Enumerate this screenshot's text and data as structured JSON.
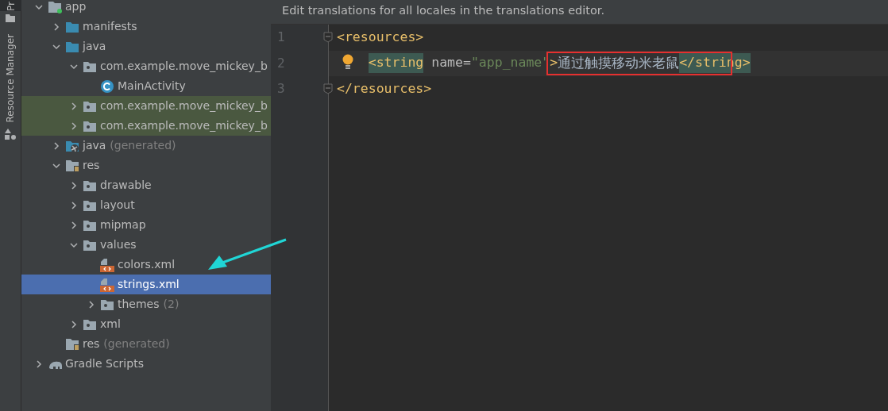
{
  "tool_strip": [
    {
      "label": "Pr",
      "selected": true
    },
    {
      "label": "Resource Manager",
      "selected": false
    }
  ],
  "tree": [
    {
      "label": "app",
      "kind": "module",
      "expanded": true,
      "selected": false,
      "highlighted": false,
      "children": [
        {
          "label": "manifests",
          "kind": "folder",
          "expanded": false,
          "selected": false,
          "highlighted": false
        },
        {
          "label": "java",
          "kind": "folder",
          "expanded": true,
          "selected": false,
          "highlighted": false,
          "children": [
            {
              "label": "com.example.move_mickey_b",
              "kind": "package",
              "expanded": true,
              "selected": false,
              "highlighted": false,
              "children": [
                {
                  "label": "MainActivity",
                  "kind": "class",
                  "selected": false,
                  "highlighted": false
                }
              ]
            },
            {
              "label": "com.example.move_mickey_b",
              "kind": "package",
              "expanded": false,
              "selected": false,
              "highlighted": true
            },
            {
              "label": "com.example.move_mickey_b",
              "kind": "package",
              "expanded": false,
              "selected": false,
              "highlighted": true
            }
          ]
        },
        {
          "label": "java",
          "note": "(generated)",
          "kind": "generated",
          "expanded": false,
          "selected": false,
          "highlighted": false
        },
        {
          "label": "res",
          "kind": "res",
          "expanded": true,
          "selected": false,
          "highlighted": false,
          "children": [
            {
              "label": "drawable",
              "kind": "package",
              "expanded": false,
              "selected": false,
              "highlighted": false
            },
            {
              "label": "layout",
              "kind": "package",
              "expanded": false,
              "selected": false,
              "highlighted": false
            },
            {
              "label": "mipmap",
              "kind": "package",
              "expanded": false,
              "selected": false,
              "highlighted": false
            },
            {
              "label": "values",
              "kind": "package",
              "expanded": true,
              "selected": false,
              "highlighted": false,
              "children": [
                {
                  "label": "colors.xml",
                  "kind": "xml",
                  "selected": false,
                  "highlighted": false
                },
                {
                  "label": "strings.xml",
                  "kind": "xml",
                  "selected": true,
                  "highlighted": false
                },
                {
                  "label": "themes",
                  "note": "(2)",
                  "kind": "package",
                  "expanded": false,
                  "selected": false,
                  "highlighted": false
                }
              ]
            },
            {
              "label": "xml",
              "kind": "package",
              "expanded": false,
              "selected": false,
              "highlighted": false
            }
          ]
        },
        {
          "label": "res",
          "note": "(generated)",
          "kind": "res",
          "selected": false,
          "highlighted": false
        }
      ]
    },
    {
      "label": "Gradle Scripts",
      "kind": "gradle",
      "expanded": false,
      "selected": false,
      "highlighted": false
    }
  ],
  "editor": {
    "banner": "Edit translations for all locales in the translations editor.",
    "lines": [
      {
        "number": "1",
        "fold": true,
        "bulb": false,
        "current": false,
        "indented": false,
        "tokens": [
          {
            "text": "<resources>",
            "kind": "tag",
            "highlighted": false
          }
        ]
      },
      {
        "number": "2",
        "fold": false,
        "bulb": true,
        "current": true,
        "indented": true,
        "boxed": true,
        "tokens": [
          {
            "text": "<string",
            "kind": "tag",
            "highlighted": true
          },
          {
            "text": " name",
            "kind": "attr",
            "highlighted": false
          },
          {
            "text": "=",
            "kind": "attr",
            "highlighted": false
          },
          {
            "text": "\"app_name\"",
            "kind": "string",
            "highlighted": false
          },
          {
            "text": ">",
            "kind": "tag",
            "highlighted": false
          },
          {
            "text": "通过触摸移动米老鼠",
            "kind": "text",
            "highlighted": false
          },
          {
            "text": "</string>",
            "kind": "tag",
            "highlighted": true
          }
        ]
      },
      {
        "number": "3",
        "fold": true,
        "bulb": false,
        "current": false,
        "indented": false,
        "tokens": [
          {
            "text": "</resources>",
            "kind": "tag",
            "highlighted": false
          }
        ]
      }
    ]
  }
}
